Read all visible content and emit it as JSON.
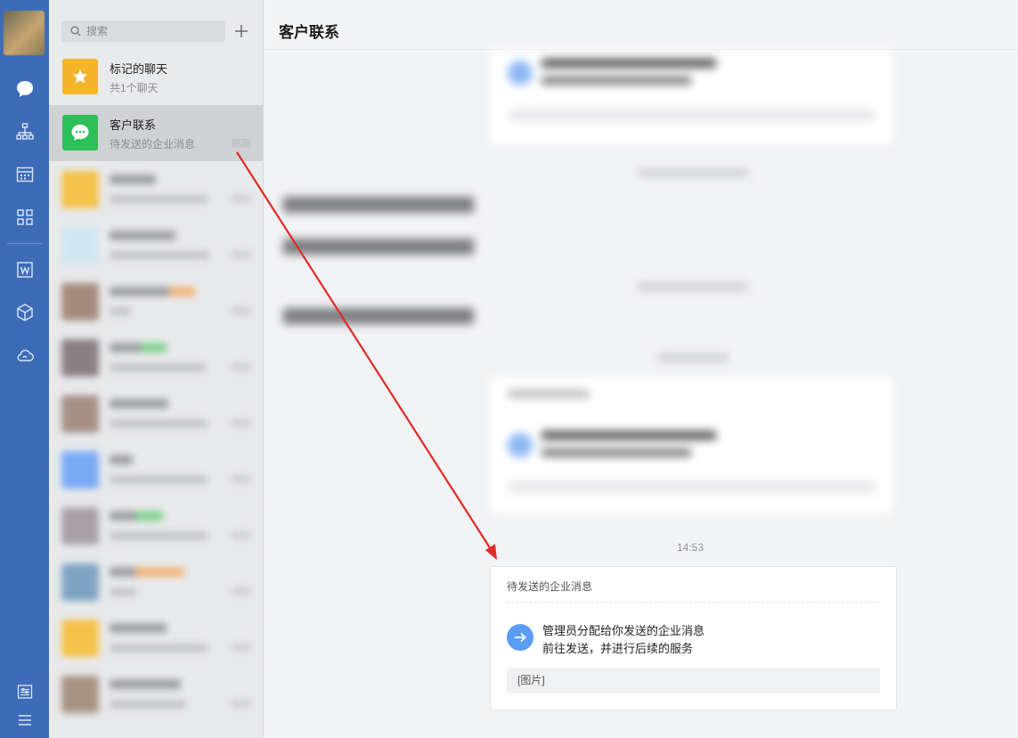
{
  "search": {
    "placeholder": "搜索"
  },
  "chats": [
    {
      "title": "标记的聊天",
      "subtitle": "共1个聊天",
      "time": ""
    },
    {
      "title": "客户联系",
      "subtitle": "待发送的企业消息",
      "time": "刚刚"
    }
  ],
  "main": {
    "title": "客户联系",
    "timestamp": "14:53",
    "card": {
      "title": "待发送的企业消息",
      "line1": "管理员分配给你发送的企业消息",
      "line2": "前往发送，并进行后续的服务",
      "attachment": "[图片]"
    }
  },
  "colors": {
    "rail": "#3d6bb6",
    "star": "#f4b528",
    "chat_green": "#2fbf58",
    "accent_blue": "#5b9df6",
    "annotation_arrow": "#e02a2a"
  },
  "icons": {
    "rail": [
      "chat-icon",
      "org-icon",
      "calendar-icon",
      "apps-icon",
      "doc-icon",
      "cube-icon",
      "cloud-icon",
      "settings-icon",
      "menu-icon"
    ]
  }
}
